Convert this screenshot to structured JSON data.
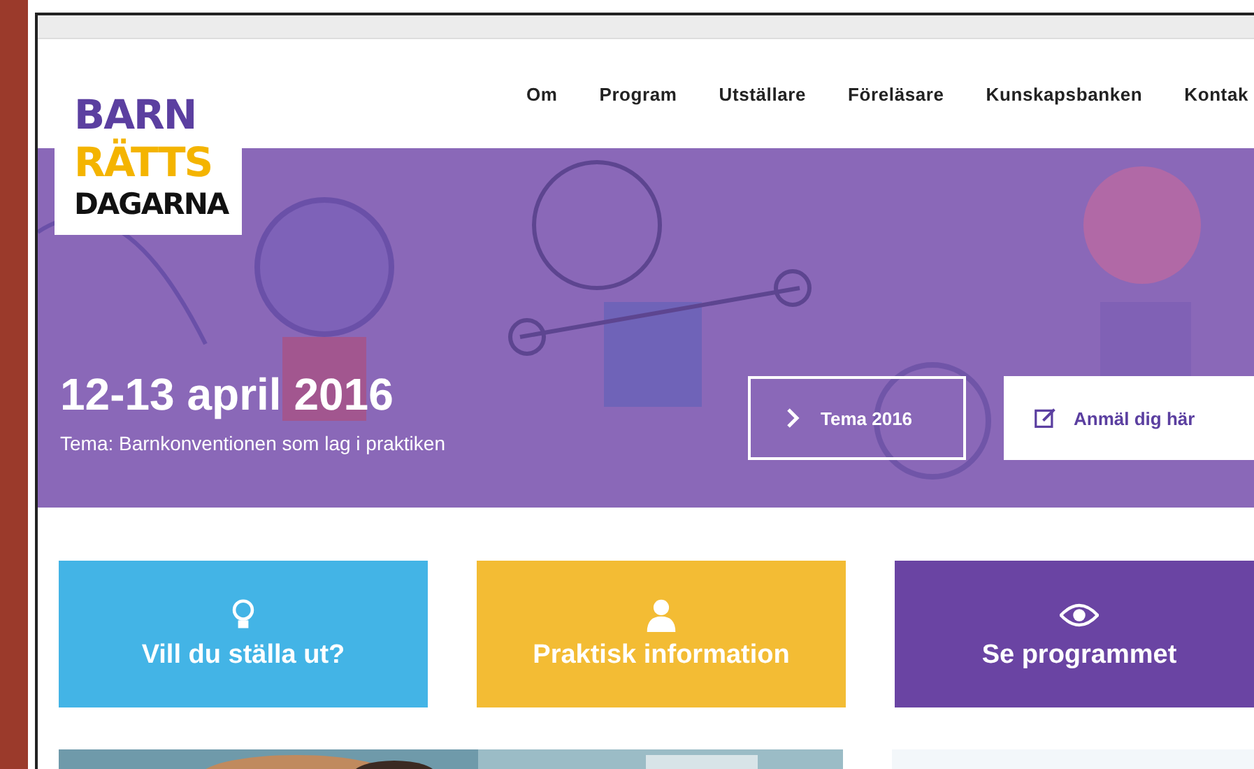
{
  "logo": {
    "lines": [
      {
        "text": "BARN",
        "color": "#5b3fa0"
      },
      {
        "text": "RÄTTS",
        "color": "#f4b400"
      },
      {
        "text": "DAGARNA",
        "color": "#111111"
      }
    ]
  },
  "nav": [
    {
      "label": "Om"
    },
    {
      "label": "Program"
    },
    {
      "label": "Utställare"
    },
    {
      "label": "Föreläsare"
    },
    {
      "label": "Kunskapsbanken"
    },
    {
      "label": "Kontak"
    }
  ],
  "hero": {
    "date": "12-13 april 2016",
    "subtitle": "Tema: Barnkonventionen som lag i praktiken",
    "buttons": [
      {
        "kind": "outline",
        "label": "Tema 2016"
      },
      {
        "kind": "solid",
        "label": "Anmäl dig här"
      }
    ]
  },
  "tiles": [
    {
      "kind": "bulb",
      "label": "Vill du ställa ut?",
      "color": "#43b4e6"
    },
    {
      "kind": "person",
      "label": "Praktisk information",
      "color": "#f3bc34"
    },
    {
      "kind": "eye",
      "label": "Se programmet",
      "color": "#6a44a3"
    }
  ]
}
